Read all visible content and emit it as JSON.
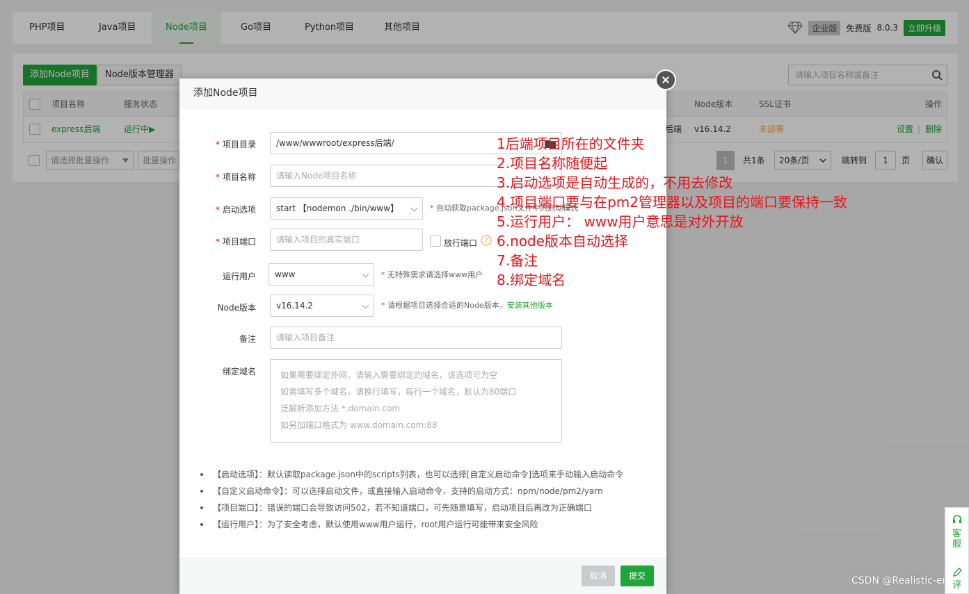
{
  "tabs": [
    "PHP项目",
    "Java项目",
    "Node项目",
    "Go项目",
    "Python项目",
    "其他项目"
  ],
  "topright": {
    "edition": "企业版",
    "free": "免费版",
    "version": "8.0.3",
    "upgrade": "立即升级"
  },
  "panel": {
    "add_button": "添加Node项目",
    "version_manager": "Node版本管理器",
    "search_placeholder": "请输入项目名称或备注",
    "headers": {
      "name": "项目名称",
      "status": "服务状态",
      "node_version": "Node版本",
      "ssl": "SSL证书",
      "ops": "操作"
    },
    "row": {
      "name": "express后端",
      "status": "运行中▶",
      "remark": "后端",
      "node_version": "v16.14.2",
      "ssl": "未部署",
      "settings": "设置",
      "sep": "|",
      "delete": "删除"
    },
    "batch_select": "请选择批量操作",
    "batch_button": "批量操作",
    "pager": {
      "page": "1",
      "total": "共1条",
      "per_page": "20条/页",
      "jump": "跳转到",
      "jump_page": "1",
      "page_unit": "页",
      "confirm": "确认"
    }
  },
  "modal": {
    "title": "添加Node项目",
    "fields": {
      "dir_label": "项目目录",
      "dir_value": "/www/wwwroot/express后端/",
      "name_label": "项目名称",
      "name_placeholder": "请输入Node项目名称",
      "start_label": "启动选项",
      "start_value": "start 【nodemon ./bin/www】",
      "start_hint": "* 自动获取package.json文件中的启动模式",
      "port_label": "项目端口",
      "port_placeholder": "请输入项目的真实端口",
      "open_port": "放行端口",
      "user_label": "运行用户",
      "user_value": "www",
      "user_hint": "* 无特殊需求请选择www用户",
      "node_label": "Node版本",
      "node_value": "v16.14.2",
      "node_hint": "* 请根据项目选择合适的Node版本，",
      "node_link": "安装其他版本",
      "remark_label": "备注",
      "remark_placeholder": "请输入项目备注",
      "domain_label": "绑定域名",
      "domain_lines": [
        "如果需要绑定外网，请输入需要绑定的域名，该选项可为空",
        "如需填写多个域名，请换行填写，每行一个域名，默认为80端口",
        "泛解析添加方法 *.domain.com",
        "如另加端口格式为 www.domain.com:88"
      ]
    },
    "tips": [
      "【启动选项】：默认读取package.json中的scripts列表，也可以选择[自定义启动命令]选项来手动输入启动命令",
      "【自定义启动命令】：可以选择启动文件，或直接输入启动命令，支持的启动方式：npm/node/pm2/yarn",
      "【项目端口】：错误的端口会导致访问502，若不知道端口，可先随意填写，启动项目后再改为正确端口",
      "【运行用户】：为了安全考虑，默认使用www用户运行，root用户运行可能带来安全风险"
    ],
    "cancel": "取消",
    "submit": "提交"
  },
  "annotations": [
    "1后端项目所在的文件夹",
    "2.项目名称随便起",
    "3.启动选项是自动生成的，不用去修改",
    "4.项目端口要与在pm2管理器以及项目的端口要保持一致",
    "5.运行用户：  www用户意思是对外开放",
    "6.node版本自动选择",
    "7.备注",
    "8.绑定域名"
  ],
  "side": {
    "service": "客服",
    "feedback": "评"
  },
  "watermark": "CSDN @Realistic-er",
  "colors": {
    "accent": "#20a53a",
    "annotation": "#e8131a",
    "warning": "#f0ad4e"
  }
}
